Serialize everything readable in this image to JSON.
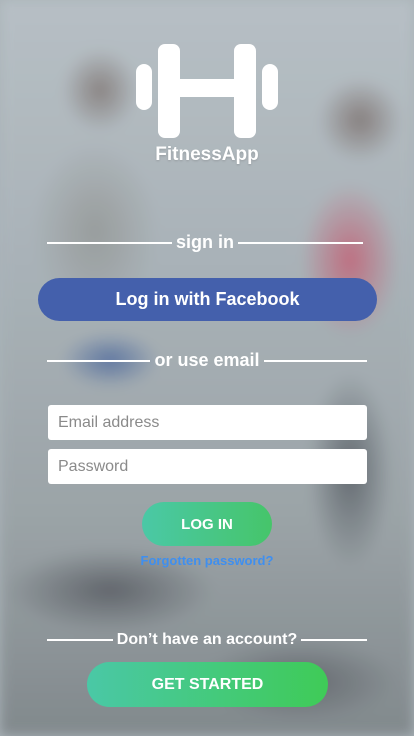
{
  "app": {
    "name": "FitnessApp"
  },
  "logo": {
    "icon": "dumbbell-icon"
  },
  "sections": {
    "sign_in_label": "sign in",
    "email_label": "or use email",
    "no_account_label": "Don’t have an account?"
  },
  "facebook": {
    "label": "Log in with Facebook",
    "color": "#4460ac"
  },
  "form": {
    "email_placeholder": "Email address",
    "password_placeholder": "Password",
    "login_label": "LOG IN",
    "forgot_label": "Forgotten password?"
  },
  "signup": {
    "label": "GET STARTED"
  },
  "colors": {
    "accent_start": "#4ac8a6",
    "accent_end": "#46c56a",
    "link": "#3f8fef"
  }
}
